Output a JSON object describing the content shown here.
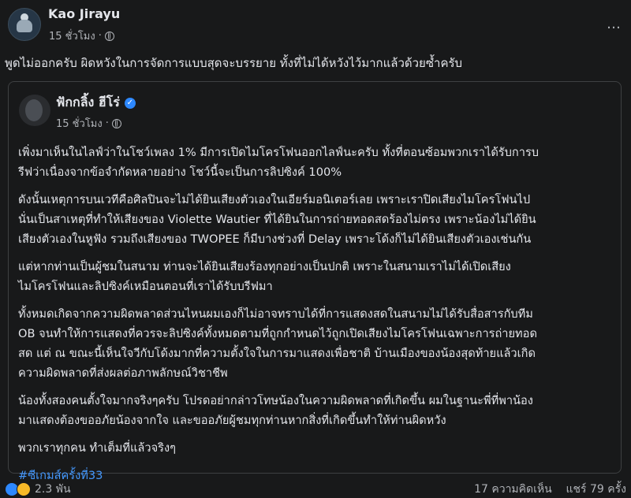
{
  "post": {
    "author": "Kao Jirayu",
    "time": "15 ชั่วโมง",
    "separator": "·",
    "text": "พูดไม่ออกครับ ผิดหวังในการจัดการแบบสุดจะบรรยาย ทั้งที่ไม่ได้หวังไว้มากแล้วด้วยซ้ำครับ",
    "more_icon": "…"
  },
  "shared": {
    "author": "ฟักกลิ้ง ฮีโร่",
    "verified_icon": "✓",
    "time": "15 ชั่วโมง",
    "separator": "·",
    "paragraphs": [
      "เพิ่งมาเห็นในไลฟ์ว่าในโชว์เพลง 1% มีการเปิดไมโครโฟนออกไลฟ์นะครับ ทั้งที่ตอนซ้อมพวกเราได้รับการบ\nรีฟว่าเนื่องจากข้อจำกัดหลายอย่าง โชว์นี้จะเป็นการลิปซิงค์ 100%",
      "ดังนั้นเหตุการบนเวทีคือศิลปินจะไม่ได้ยินเสียงตัวเองในเอียร์มอนิเตอร์เลย เพราะเราปิดเสียงไมโครโฟนไป\nนั่นเป็นสาเหตุที่ทำให้เสียงของ Violette Wautier ที่ได้ยินในการถ่ายทอดสดร้องไม่ตรง เพราะน้องไม่ได้ยิน\nเสียงตัวเองในหูฟัง รวมถึงเสียงของ TWOPEE ก็มีบางช่วงที่ Delay เพราะโด้งก็ไม่ได้ยินเสียงตัวเองเช่นกัน",
      "แต่หากท่านเป็นผู้ชมในสนาม ท่านจะได้ยินเสียงร้องทุกอย่างเป็นปกติ เพราะในสนามเราไม่ได้เปิดเสียง\nไมโครโฟนและลิปซิงค์เหมือนตอนที่เราได้รับบรีฟมา",
      "ทั้งหมดเกิดจากความผิดพลาดส่วนไหนผมเองก็ไม่อาจทราบได้ที่การแสดงสดในสนามไม่ได้รับสื่อสารกับทีม\nOB จนทำให้การแสดงที่ควรจะลิปซิงค์ทั้งหมดตามที่ถูกกำหนดไว้ถูกเปิดเสียงไมโครโฟนเฉพาะการถ่ายทอด\nสด แต่ ณ ขณะนี้เห็นใจวีกับโด้งมากที่ความตั้งใจในการมาแสดงเพื่อชาติ บ้านเมืองของน้องสุดท้ายแล้วเกิด\nความผิดพลาดที่ส่งผลต่อภาพลักษณ์วิชาชีพ",
      "น้องทั้งสองคนตั้งใจมากจริงๆครับ โปรดอย่ากล่าวโทษน้องในความผิดพลาดที่เกิดขึ้น ผมในฐานะพี่ที่พาน้อง\nมาแสดงต้องขออภัยน้องจากใจ และขออภัยผู้ชมทุกท่านหากสิ่งที่เกิดขึ้นทำให้ท่านผิดหวัง",
      "พวกเราทุกคน ทำเต็มที่แล้วจริงๆ"
    ],
    "hashtag": "#ซีเกมส์ครั้งที่33"
  },
  "footer": {
    "reaction_count": "2.3 พัน",
    "comments": "17 ความคิดเห็น",
    "shares": "แชร์ 79 ครั้ง"
  },
  "icons": {
    "globe": "globe-icon",
    "more": "more-icon",
    "verified": "verified-badge-icon"
  },
  "colors": {
    "background": "#18191a",
    "text": "#e4e6eb",
    "secondary": "#b0b3b8",
    "link": "#4599ff",
    "verified": "#2d88ff"
  }
}
